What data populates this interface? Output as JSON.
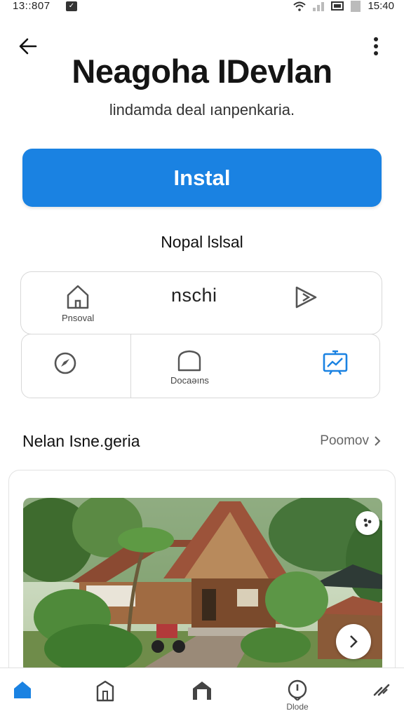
{
  "status_bar": {
    "time_left": "13::807",
    "time_right": "15:40"
  },
  "app": {
    "title": "Neagoha IDevlan",
    "subtitle": "lindamda deal ıanpenkaria.",
    "install_label": "Instal"
  },
  "section_label": "Nopal lslsal",
  "grid": {
    "items": [
      {
        "icon": "home-icon",
        "label": "Pnsoval"
      },
      {
        "icon": "",
        "label": "nschi"
      },
      {
        "icon": "play-icon",
        "label": ""
      },
      {
        "icon": "compass-icon",
        "label": ""
      },
      {
        "icon": "home-outline-icon",
        "label": "Docaəıns"
      },
      {
        "icon": "presentation-icon",
        "label": ""
      }
    ]
  },
  "featured": {
    "title": "Nelan Isne.geria",
    "link_label": "Poomov"
  },
  "bottom_nav": {
    "items": [
      {
        "icon": "home-icon",
        "label": "",
        "active": true
      },
      {
        "icon": "door-icon",
        "label": ""
      },
      {
        "icon": "house-icon",
        "label": ""
      },
      {
        "icon": "info-icon",
        "label": "Dlode"
      },
      {
        "icon": "tools-icon",
        "label": ""
      }
    ]
  },
  "colors": {
    "primary": "#1a82e2",
    "text": "#141414",
    "border": "#d8d8d8"
  }
}
